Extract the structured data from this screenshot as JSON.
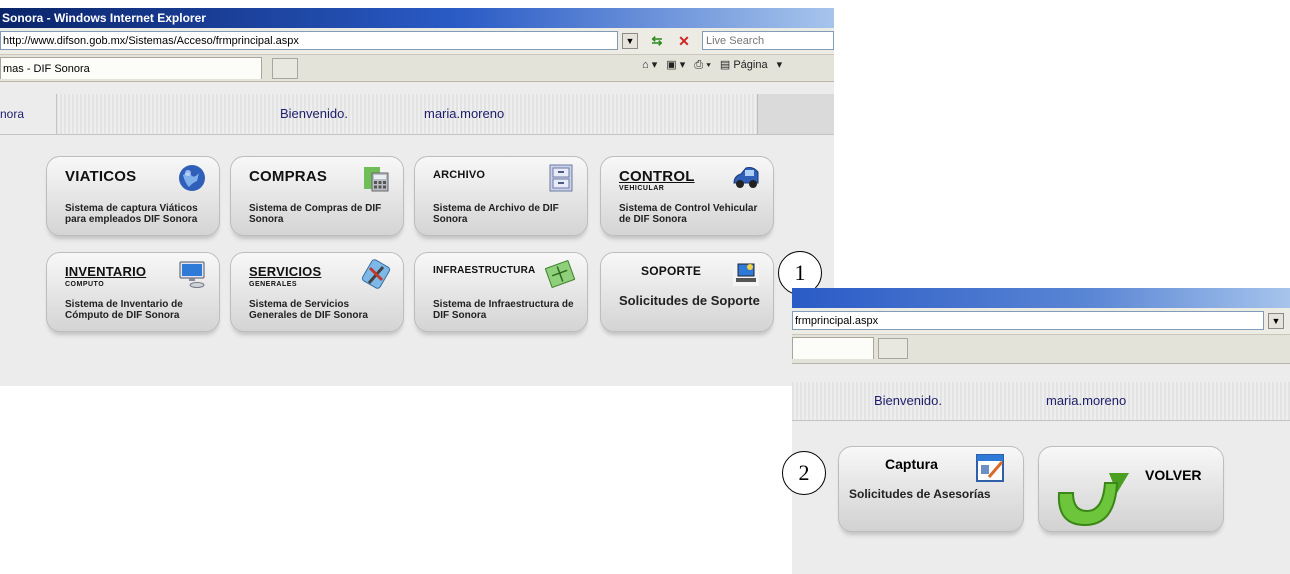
{
  "browser": {
    "title": "Sonora - Windows Internet Explorer",
    "url": "http://www.difson.gob.mx/Sistemas/Acceso/frmprincipal.aspx",
    "search_placeholder": "Live Search",
    "tab_title": "mas - DIF Sonora",
    "command_bar": [
      "Página"
    ]
  },
  "header": {
    "site_label": "nora",
    "welcome": "Bienvenido.",
    "user": "maria.moreno"
  },
  "tiles": [
    {
      "title": "VIATICOS",
      "subtitle": "",
      "desc": "Sistema de captura Viáticos para empleados DIF Sonora",
      "icon": "globe-icon"
    },
    {
      "title": "COMPRAS",
      "subtitle": "",
      "desc": "Sistema de Compras de DIF Sonora",
      "icon": "calculator-icon"
    },
    {
      "title": "ARCHIVO",
      "subtitle": "",
      "desc": "Sistema de Archivo de DIF Sonora",
      "icon": "file-cabinet-icon"
    },
    {
      "title": "CONTROL",
      "subtitle": "VEHICULAR",
      "desc": "Sistema de Control Vehicular de DIF Sonora",
      "icon": "car-icon"
    },
    {
      "title": "INVENTARIO",
      "subtitle": "COMPUTO",
      "desc": "Sistema de Inventario de Cómputo de DIF Sonora",
      "icon": "monitor-icon"
    },
    {
      "title": "SERVICIOS",
      "subtitle": "GENERALES",
      "desc": "Sistema de Servicios Generales de DIF Sonora",
      "icon": "tools-icon"
    },
    {
      "title": "INFRAESTRUCTURA",
      "subtitle": "",
      "desc": "Sistema de Infraestructura de DIF Sonora",
      "icon": "blueprint-icon"
    },
    {
      "title": "SOPORTE",
      "subtitle": "",
      "desc": "Solicitudes de Soporte",
      "icon": "support-computer-icon"
    }
  ],
  "callouts": [
    "1",
    "2"
  ],
  "detail": {
    "url": "frmprincipal.aspx",
    "welcome": "Bienvenido.",
    "user": "maria.moreno",
    "capture_title": "Captura",
    "capture_desc": "Solicitudes de Asesorías",
    "back_label": "VOLVER"
  },
  "colors": {
    "title_bar": "#0a246a",
    "header_text": "#1d1d6b",
    "tile_bg": "#e4e4e4",
    "back_arrow": "#5bb82a"
  }
}
